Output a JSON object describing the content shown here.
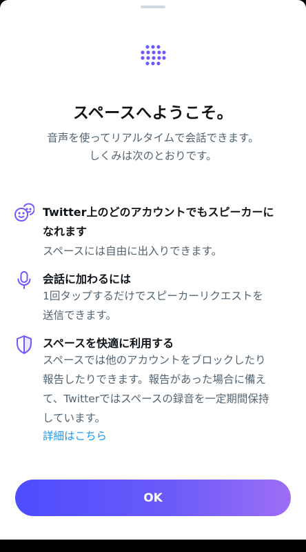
{
  "colors": {
    "accent_purple": "#7856ff",
    "link_blue": "#1d9bf0",
    "button_gradient_start": "#4c4dff",
    "button_gradient_end": "#9d6ef5",
    "heading_text": "#0f1419",
    "secondary_text": "#536471"
  },
  "header": {
    "logo_icon": "spaces-dots-icon",
    "title": "スペースへようこそ。",
    "subtitle_line1": "音声を使ってリアルタイムで会話できます。",
    "subtitle_line2": "しくみは次のとおりです。"
  },
  "features": [
    {
      "icon": "smiley-faces-icon",
      "heading_line1": "Twitter上のどのアカウントでもスピーカーに",
      "heading_line2": "なれます",
      "desc_line1": "スペースには自由に出入りできます。"
    },
    {
      "icon": "microphone-icon",
      "heading_line1": "会話に加わるには",
      "desc_line1": "1回タップするだけでスピーカーリクエストを",
      "desc_line2": "送信できます。"
    },
    {
      "icon": "shield-icon",
      "heading_line1": "スペースを快適に利用する",
      "desc_line1": "スペースでは他のアカウントをブロックしたり",
      "desc_line2": "報告したりできます。報告があった場合に備え",
      "desc_line3": "て、Twitterではスペースの録音を一定期間保持",
      "desc_line4": "しています。"
    }
  ],
  "learn_more_link": "詳細はこちら",
  "ok_button_label": "OK"
}
